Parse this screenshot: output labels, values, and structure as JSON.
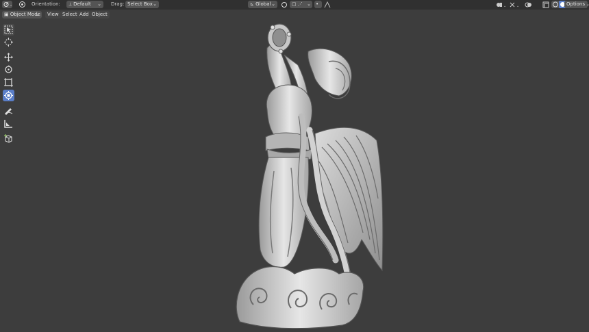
{
  "header": {
    "orientation_label": "Orientation:",
    "orientation_value": "Default",
    "drag_label": "Drag:",
    "drag_value": "Select Box",
    "transform_space": "Global",
    "options_label": "Options"
  },
  "header2": {
    "mode": "Object Mode",
    "menus": [
      "View",
      "Select",
      "Add",
      "Object"
    ]
  },
  "toolbar": {
    "tools": [
      "select-box",
      "cursor",
      "move",
      "rotate",
      "scale",
      "transform",
      "annotate",
      "measure",
      "add-cube"
    ],
    "active_tool": "transform"
  },
  "colors": {
    "viewport_bg": "#3d3d3d",
    "header_bg": "#303030",
    "active_tool": "#5a7ec8"
  }
}
